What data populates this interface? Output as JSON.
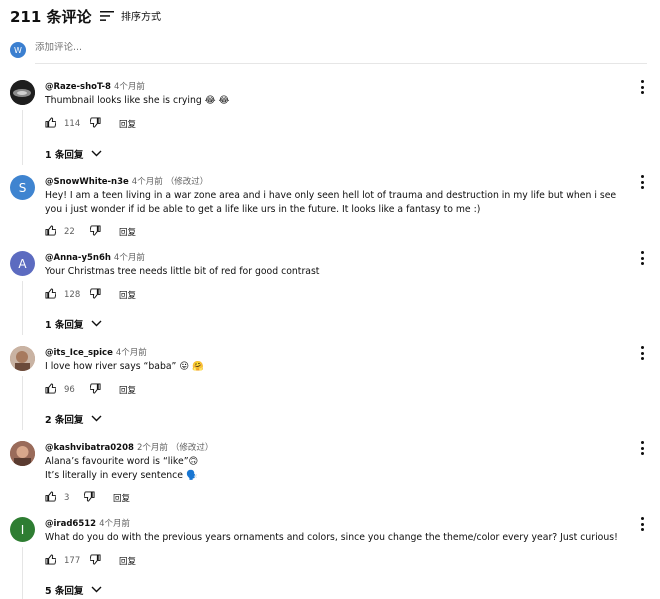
{
  "header": {
    "comment_count": "211 条评论",
    "sort_label": "排序方式"
  },
  "add_comment": {
    "avatar_letter": "W",
    "placeholder": "添加评论..."
  },
  "colors": {
    "accent_blue": "#3b7fd0",
    "text": "#0f0f0f",
    "secondary": "#606060"
  },
  "comments": [
    {
      "author": "@Raze-shoT-8",
      "time": "4个月前",
      "edited": "",
      "avatar_letter": "",
      "avatar_color": "#2b2b2b",
      "lines": [
        "Thumbnail looks like she is crying 😂 😂"
      ],
      "likes": "114",
      "reply_label": "回复",
      "replies_label": "1 条回复"
    },
    {
      "author": "@SnowWhite-n3e",
      "time": "4个月前",
      "edited": "（修改过）",
      "avatar_letter": "S",
      "avatar_color": "#3f84d0",
      "lines": [
        "Hey! I am a teen living in a war zone area and i have only seen hell lot of trauma and destruction in my life but when i see you i just wonder if id be able to get a life like urs in the future. It looks like a fantasy to me :)"
      ],
      "likes": "22",
      "reply_label": "回复",
      "replies_label": ""
    },
    {
      "author": "@Anna-y5n6h",
      "time": "4个月前",
      "edited": "",
      "avatar_letter": "A",
      "avatar_color": "#5c6bc0",
      "lines": [
        "Your Christmas tree needs little bit of red for good contrast"
      ],
      "likes": "128",
      "reply_label": "回复",
      "replies_label": "1 条回复"
    },
    {
      "author": "@its_Ice_spice",
      "time": "4个月前",
      "edited": "",
      "avatar_letter": "",
      "avatar_color": "#b58a6a",
      "lines": [
        "I love how river says “baba” 😛 🤗"
      ],
      "likes": "96",
      "reply_label": "回复",
      "replies_label": "2 条回复"
    },
    {
      "author": "@kashvibatra0208",
      "time": "2个月前",
      "edited": "（修改过）",
      "avatar_letter": "",
      "avatar_color": "#8a5a4a",
      "lines": [
        "Alana’s favourite word is “like”🙃",
        "It’s literally in every sentence 🗣️"
      ],
      "likes": "3",
      "reply_label": "回复",
      "replies_label": ""
    },
    {
      "author": "@irad6512",
      "time": "4个月前",
      "edited": "",
      "avatar_letter": "I",
      "avatar_color": "#2e7d32",
      "lines": [
        "What do you do with the previous years ornaments and colors, since you change the theme/color every year? Just curious!"
      ],
      "likes": "177",
      "reply_label": "回复",
      "replies_label": "5 条回复"
    }
  ]
}
